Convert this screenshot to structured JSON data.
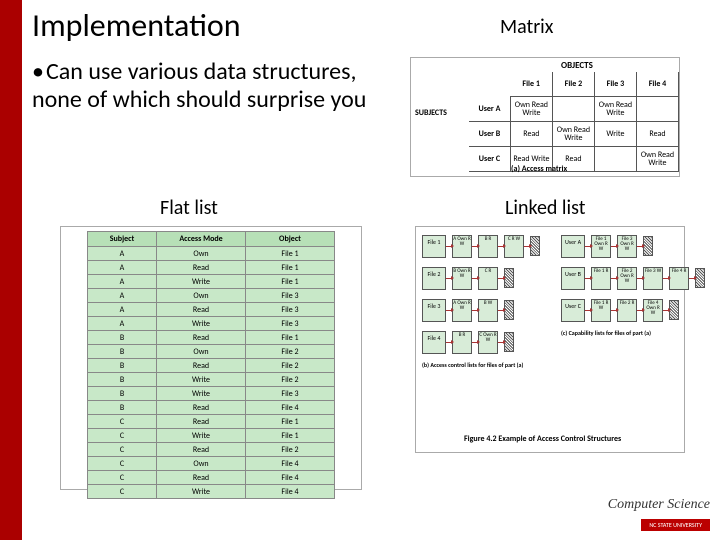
{
  "title": "Implementation",
  "labels": {
    "matrix": "Matrix",
    "flat": "Flat list",
    "linked": "Linked list"
  },
  "bullet": "Can use various data structures, none of which should surprise you",
  "matrix": {
    "objects_hdr": "OBJECTS",
    "subjects_hdr": "SUBJECTS",
    "cols": [
      "File 1",
      "File 2",
      "File 3",
      "File 4"
    ],
    "rows": [
      {
        "subject": "User A",
        "cells": [
          "Own Read Write",
          "",
          "Own Read Write",
          ""
        ]
      },
      {
        "subject": "User B",
        "cells": [
          "Read",
          "Own Read Write",
          "Write",
          "Read"
        ]
      },
      {
        "subject": "User C",
        "cells": [
          "Read Write",
          "Read",
          "",
          "Own Read Write"
        ]
      }
    ],
    "caption": "(a) Access matrix"
  },
  "flatlist": {
    "headers": [
      "Subject",
      "Access Mode",
      "Object"
    ],
    "rows": [
      [
        "A",
        "Own",
        "File 1"
      ],
      [
        "A",
        "Read",
        "File 1"
      ],
      [
        "A",
        "Write",
        "File 1"
      ],
      [
        "A",
        "Own",
        "File 3"
      ],
      [
        "A",
        "Read",
        "File 3"
      ],
      [
        "A",
        "Write",
        "File 3"
      ],
      [
        "B",
        "Read",
        "File 1"
      ],
      [
        "B",
        "Own",
        "File 2"
      ],
      [
        "B",
        "Read",
        "File 2"
      ],
      [
        "B",
        "Write",
        "File 2"
      ],
      [
        "B",
        "Write",
        "File 3"
      ],
      [
        "B",
        "Read",
        "File 4"
      ],
      [
        "C",
        "Read",
        "File 1"
      ],
      [
        "C",
        "Write",
        "File 1"
      ],
      [
        "C",
        "Read",
        "File 2"
      ],
      [
        "C",
        "Own",
        "File 4"
      ],
      [
        "C",
        "Read",
        "File 4"
      ],
      [
        "C",
        "Write",
        "File 4"
      ]
    ]
  },
  "linked": {
    "acl": {
      "rows": [
        {
          "head": "File 1",
          "nodes": [
            "A Own R W",
            "B R",
            "C R W"
          ]
        },
        {
          "head": "File 2",
          "nodes": [
            "B Own R W",
            "C R"
          ]
        },
        {
          "head": "File 3",
          "nodes": [
            "A Own R W",
            "B W"
          ]
        },
        {
          "head": "File 4",
          "nodes": [
            "B R",
            "C Own R W"
          ]
        }
      ],
      "caption": "(b) Access control lists for files of part (a)"
    },
    "cap": {
      "rows": [
        {
          "head": "User A",
          "nodes": [
            "File 1 Own R W",
            "File 3 Own R W"
          ]
        },
        {
          "head": "User B",
          "nodes": [
            "File 1 R",
            "File 2 Own R W",
            "File 3 W",
            "File 4 R"
          ]
        },
        {
          "head": "User C",
          "nodes": [
            "File 1 R W",
            "File 2 R",
            "File 4 Own R W"
          ]
        }
      ],
      "caption": "(c) Capability lists for files of part (a)"
    },
    "figure_caption": "Figure 4.2  Example of Access Control Structures"
  },
  "footer": {
    "logo_text": "Computer Science",
    "badge": "NC STATE UNIVERSITY"
  }
}
